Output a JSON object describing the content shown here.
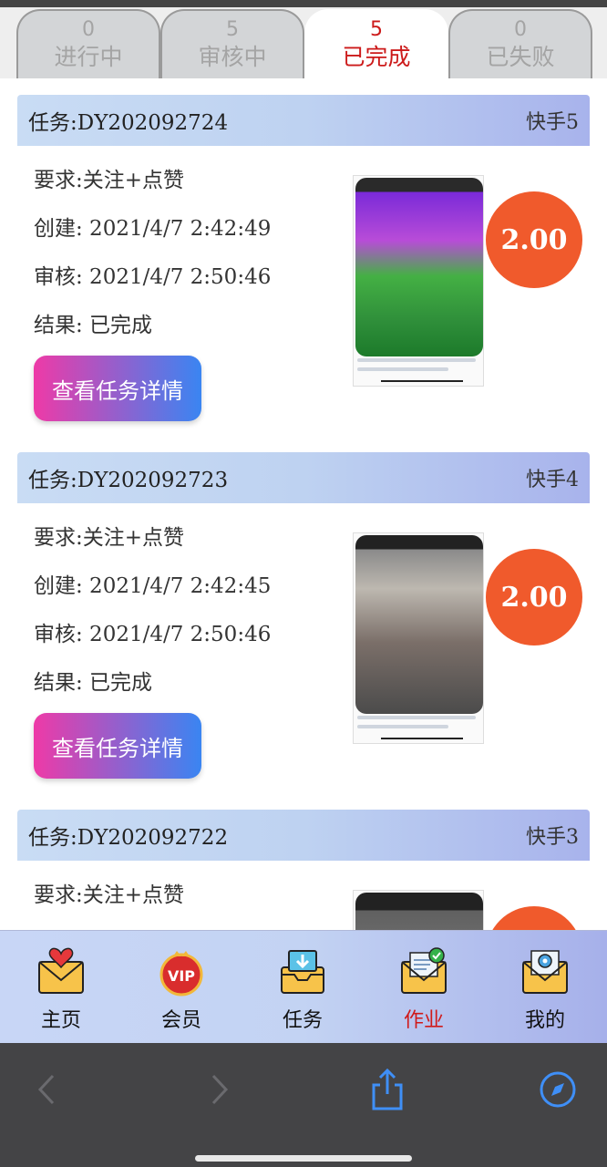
{
  "tabs": [
    {
      "count": "0",
      "label": "进行中"
    },
    {
      "count": "5",
      "label": "审核中"
    },
    {
      "count": "5",
      "label": "已完成"
    },
    {
      "count": "0",
      "label": "已失败"
    }
  ],
  "active_tab": 2,
  "tasks": [
    {
      "task_id": "任务:DY202092724",
      "platform": "快手5",
      "requirement": "要求:关注+点赞",
      "created": "创建: 2021/4/7 2:42:49",
      "reviewed": "审核: 2021/4/7 2:50:46",
      "result": "结果: 已完成",
      "detail_button": "查看任务详情",
      "amount": "2.00"
    },
    {
      "task_id": "任务:DY202092723",
      "platform": "快手4",
      "requirement": "要求:关注+点赞",
      "created": "创建: 2021/4/7 2:42:45",
      "reviewed": "审核: 2021/4/7 2:50:46",
      "result": "结果: 已完成",
      "detail_button": "查看任务详情",
      "amount": "2.00"
    },
    {
      "task_id": "任务:DY202092722",
      "platform": "快手3",
      "requirement": "要求:关注+点赞",
      "created": "",
      "reviewed": "",
      "result": "",
      "detail_button": "",
      "amount": ""
    }
  ],
  "bottom_nav": [
    {
      "label": "主页",
      "icon": "heart-mail-icon"
    },
    {
      "label": "会员",
      "icon": "vip-badge-icon"
    },
    {
      "label": "任务",
      "icon": "download-inbox-icon"
    },
    {
      "label": "作业",
      "icon": "checked-mail-icon"
    },
    {
      "label": "我的",
      "icon": "gear-mail-icon"
    }
  ],
  "active_nav": 3,
  "colors": {
    "active_red": "#cc1a1a",
    "amount_orange": "#f05a2c",
    "button_gradient_start": "#ee3aa7",
    "button_gradient_end": "#3a85f2",
    "safari_icon_blue": "#3f8ff7"
  }
}
